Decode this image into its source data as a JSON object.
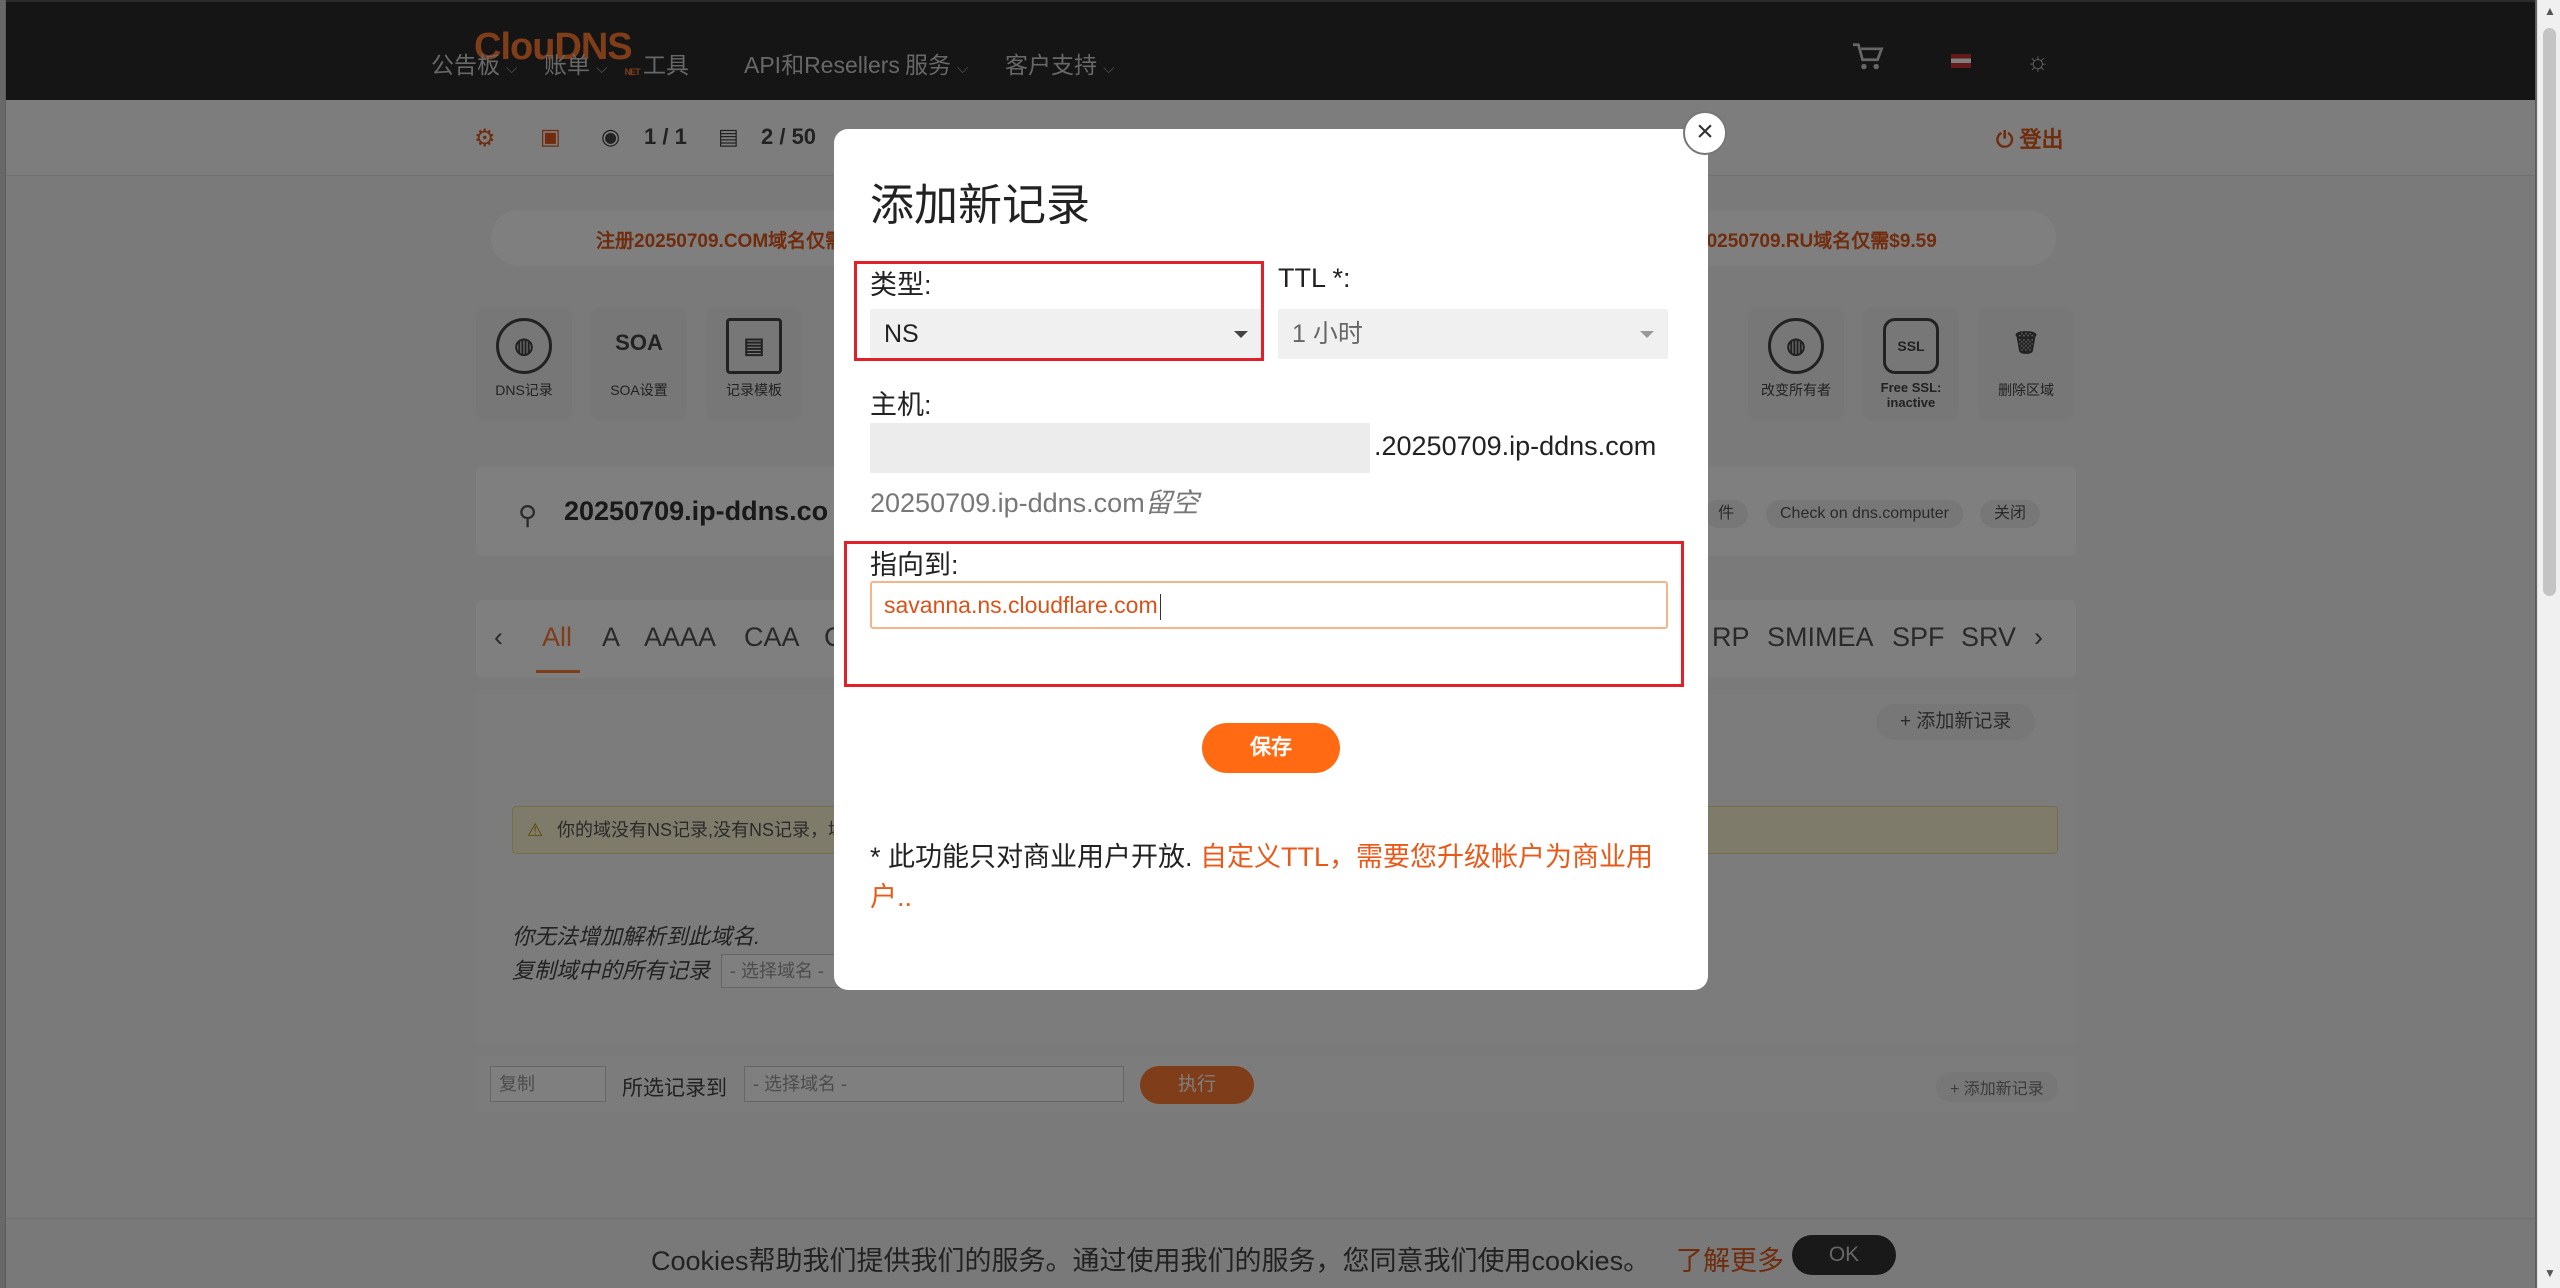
{
  "nav": {
    "logo": "ClouDNS",
    "logo_sub": "NET",
    "items": [
      {
        "label": "公告板",
        "has_dropdown": true
      },
      {
        "label": "账单",
        "has_dropdown": true
      },
      {
        "label": "工具",
        "has_dropdown": false
      },
      {
        "label": "API和Resellers",
        "has_dropdown": false
      },
      {
        "label": "服务",
        "has_dropdown": true
      },
      {
        "label": "客户支持",
        "has_dropdown": true
      }
    ],
    "icons": [
      "cart-icon",
      "flag-icon",
      "theme-icon"
    ]
  },
  "subbar": {
    "zones_count": "1 / 1",
    "records_count": "2 / 50",
    "logout": "登出"
  },
  "promo": {
    "left": "注册20250709.COM域名仅需",
    "right": "20250709.RU域名仅需$9.59"
  },
  "tools": [
    {
      "label": "DNS记录",
      "glyph": "◍"
    },
    {
      "label": "SOA设置",
      "glyph": "SOA"
    },
    {
      "label": "记录模板",
      "glyph": "▤"
    },
    {
      "label": "改变所有者",
      "glyph": "◍"
    },
    {
      "label": "Free SSL: inactive",
      "glyph": "SSL"
    },
    {
      "label": "删除区域",
      "glyph": "🗑"
    }
  ],
  "domain_bar": {
    "domain": "20250709.ip-ddns.co",
    "chips": [
      "件",
      "Check on dns.computer",
      "关闭"
    ]
  },
  "record_tabs": {
    "left": [
      "All",
      "A",
      "AAAA",
      "CAA",
      "C"
    ],
    "right": [
      "RP",
      "SMIMEA",
      "SPF",
      "SRV"
    ],
    "active": "All"
  },
  "records": {
    "add_button": "+ 添加新记录",
    "warning": "你的域没有NS记录,没有NS记录，域",
    "cannot_add": "你无法增加解析到此域名.",
    "copy_all": "复制域中的所有记录",
    "copy_select_placeholder": "- 选择域名 -"
  },
  "bottom": {
    "action": "复制",
    "label": "所选记录到",
    "select_placeholder": "- 选择域名 -",
    "exec": "执行",
    "add": "+ 添加新记录"
  },
  "cookie": {
    "text": "Cookies帮助我们提供我们的服务。通过使用我们的服务，您同意我们使用cookies。",
    "link": "了解更多",
    "ok": "OK"
  },
  "modal": {
    "close_glyph": "×",
    "title": "添加新记录",
    "type_label": "类型:",
    "type_value": "NS",
    "ttl_label": "TTL *:",
    "ttl_value": "1 小时",
    "host_label": "主机:",
    "host_value": "",
    "host_suffix": ".20250709.ip-ddns.com",
    "host_hint_domain": "20250709.ip-ddns.com",
    "host_hint_italic": "留空",
    "points_label": "指向到:",
    "points_value": "savanna.ns.cloudflare.com",
    "save": "保存",
    "note_prefix": "* 此功能只对商业用户开放.",
    "note_link": "自定义TTL，需要您升级帐户为商业用户.."
  },
  "colors": {
    "accent": "#ff6a13",
    "highlight_box": "#e2202a",
    "nav_bg": "#2b2b2b"
  }
}
